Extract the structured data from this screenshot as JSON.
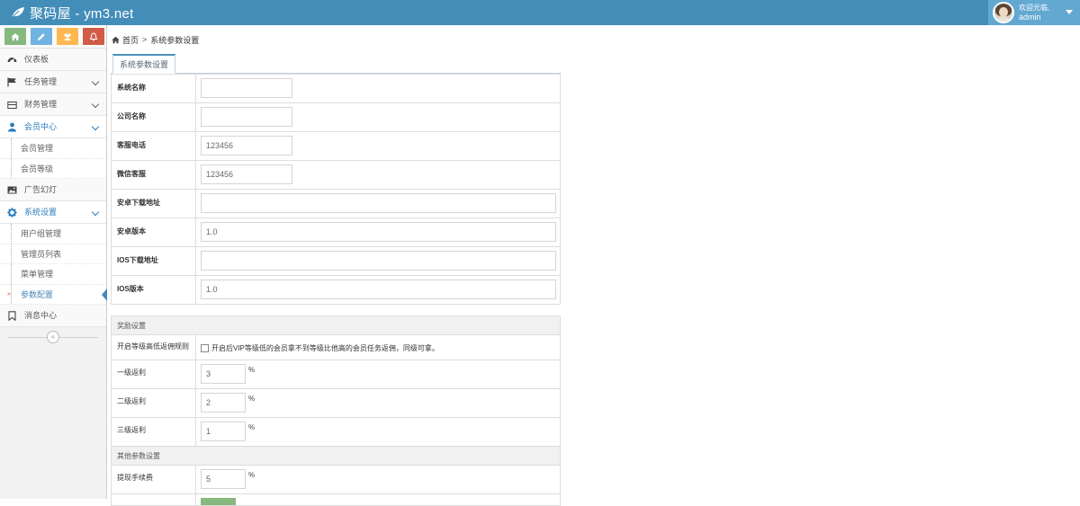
{
  "header": {
    "brand": "聚码屋 - ym3.net",
    "user": {
      "welcome": "欢迎光临,",
      "name": "admin"
    }
  },
  "shortcuts": [
    {
      "icon": "home-icon",
      "color": "#87b87f"
    },
    {
      "icon": "pencil-icon",
      "color": "#6fb3e0"
    },
    {
      "icon": "users-icon",
      "color": "#ffb752"
    },
    {
      "icon": "bell-icon",
      "color": "#d15b47"
    }
  ],
  "sidebar": {
    "items": [
      {
        "label": "仪表板",
        "icon": "dashboard-icon"
      },
      {
        "label": "任务管理",
        "icon": "flag-icon"
      },
      {
        "label": "财务管理",
        "icon": "wallet-icon"
      },
      {
        "label": "会员中心",
        "icon": "user-icon",
        "open": true,
        "children": [
          "会员管理",
          "会员等级"
        ]
      },
      {
        "label": "广告幻灯",
        "icon": "picture-icon"
      },
      {
        "label": "系统设置",
        "icon": "cog-icon",
        "open": true,
        "children": [
          "用户组管理",
          "管理员列表",
          "菜单管理",
          "参数配置"
        ]
      },
      {
        "label": "消息中心",
        "icon": "bookmark-icon"
      }
    ],
    "collapse_glyph": "«"
  },
  "breadcrumb": {
    "home": "首页",
    "separator": ">",
    "current": "系统参数设置"
  },
  "tab": {
    "label": "系统参数设置"
  },
  "form": {
    "system_name": {
      "label": "系统名称",
      "value": ""
    },
    "company_name": {
      "label": "公司名称",
      "value": ""
    },
    "service_phone": {
      "label": "客服电话",
      "value": "123456"
    },
    "wechat_service": {
      "label": "微信客服",
      "value": "123456"
    },
    "android_url": {
      "label": "安卓下载地址",
      "value": ""
    },
    "android_version": {
      "label": "安卓版本",
      "value": "1.0"
    },
    "ios_url": {
      "label": "IOS下载地址",
      "value": ""
    },
    "ios_version": {
      "label": "IOS版本",
      "value": "1.0"
    },
    "reward_section": "奖励设置",
    "level_rule": {
      "label": "开启等级高低返佣规则",
      "text": "开启后VIP等级低的会员拿不到等级比他高的会员任务返佣，同级可拿。",
      "checked": false
    },
    "rebate1": {
      "label": "一级返利",
      "value": "3",
      "unit": "%"
    },
    "rebate2": {
      "label": "二级返利",
      "value": "2",
      "unit": "%"
    },
    "rebate3": {
      "label": "三级返利",
      "value": "1",
      "unit": "%"
    },
    "other_section": "其他参数设置",
    "withdraw_fee": {
      "label": "提现手续费",
      "value": "5",
      "unit": "%"
    }
  }
}
